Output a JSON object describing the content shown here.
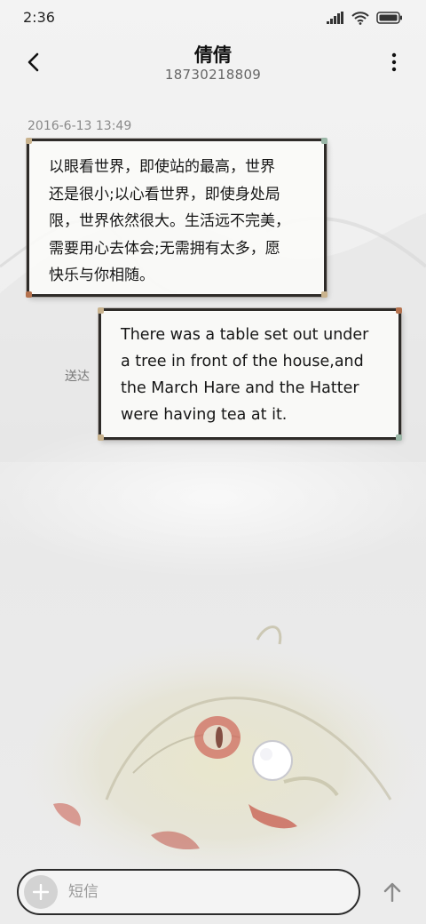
{
  "status_bar": {
    "time": "2:36",
    "icons": [
      "signal-icon",
      "wifi-icon",
      "battery-icon"
    ]
  },
  "header": {
    "contact_name": "倩倩",
    "contact_number": "18730218809",
    "back_icon": "chevron-left-icon",
    "menu_icon": "more-vertical-icon"
  },
  "conversation": {
    "timestamp": "2016-6-13 13:49",
    "messages": [
      {
        "direction": "received",
        "lines": [
          "以眼看世界，即使站的最高，世界",
          "还是很小;以心看世界，即使身处局",
          "限，世界依然很大。生活远不完美，",
          "需要用心去体会;无需拥有太多，愿",
          "快乐与你相随。"
        ]
      },
      {
        "direction": "sent",
        "status": "送达",
        "lines": [
          "There was a table set out under",
          "a tree in front of the house,and",
          "the March Hare and the Hatter",
          "were having tea at it."
        ]
      }
    ]
  },
  "composer": {
    "placeholder": "短信",
    "value": "",
    "add_icon": "plus-icon",
    "send_icon": "arrow-up-icon"
  },
  "colors": {
    "bubble_border": "#2e2b28",
    "bubble_fill": "#fafaf8",
    "accent_red": "#c0392b"
  }
}
